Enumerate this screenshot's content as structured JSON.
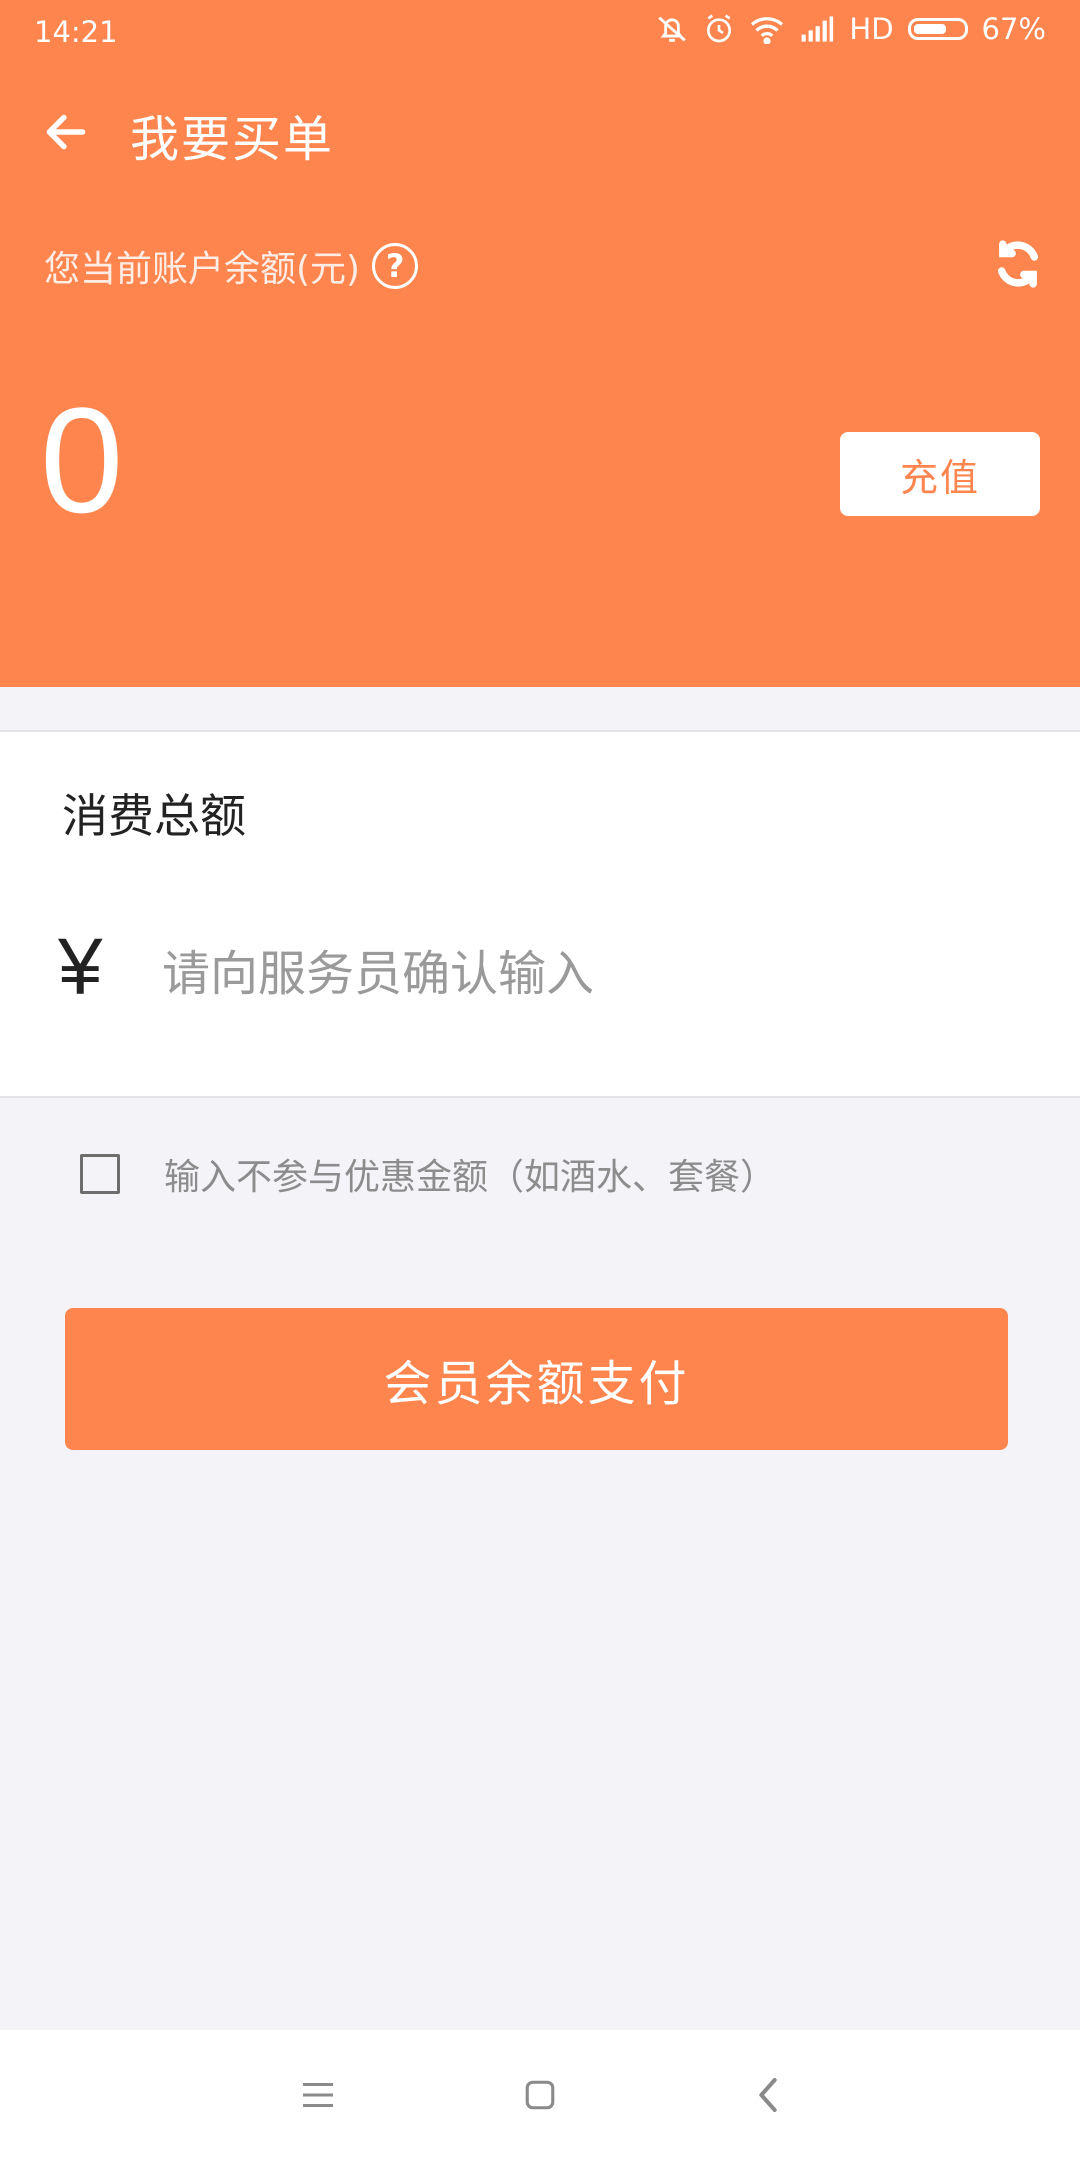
{
  "status_bar": {
    "time": "14:21",
    "network": "HD",
    "battery": "67%",
    "battery_level": 0.67,
    "icons": [
      "silent-icon",
      "alarm-icon",
      "wifi-icon",
      "signal-icon",
      "battery-icon"
    ]
  },
  "header": {
    "back_icon": "arrow-left-icon",
    "title": "我要买单",
    "balance_label": "您当前账户余额(元)",
    "help_icon": "question-circle-icon",
    "help_glyph": "?",
    "refresh_icon": "refresh-icon",
    "balance_value": "0",
    "recharge_label": "充值"
  },
  "form": {
    "section_title": "消费总额",
    "currency_symbol": "¥",
    "amount_value": "",
    "amount_placeholder": "请向服务员确认输入",
    "exclude_checked": false,
    "exclude_label": "输入不参与优惠金额（如酒水、套餐）"
  },
  "actions": {
    "pay_label": "会员余额支付"
  },
  "nav_bar": {
    "icons": [
      "menu-icon",
      "home-icon",
      "back-icon"
    ]
  },
  "colors": {
    "accent": "#ff854f",
    "background": "#f4f3f8",
    "card": "#ffffff",
    "text_primary": "#222222",
    "text_placeholder": "#9a9a9a"
  }
}
